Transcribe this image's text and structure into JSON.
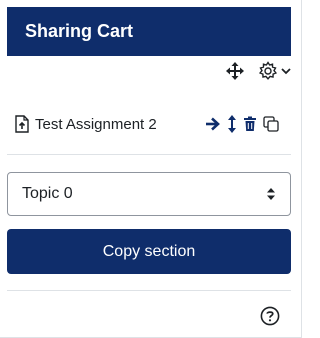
{
  "block": {
    "title": "Sharing Cart"
  },
  "controls": {
    "icons": [
      "move-icon",
      "gear-icon",
      "chevron-down-icon"
    ]
  },
  "item": {
    "label": "Test Assignment 2",
    "icons": [
      "file-upload-icon",
      "arrow-right-icon",
      "move-vertical-icon",
      "trash-icon",
      "copy-icon"
    ]
  },
  "section_select": {
    "selected": "Topic 0"
  },
  "copy_button": {
    "label": "Copy section"
  },
  "colors": {
    "header": "#0f2d6b",
    "button": "#0f2d6b",
    "icon_dark": "#0f2d6b",
    "text": "#1d2125"
  }
}
